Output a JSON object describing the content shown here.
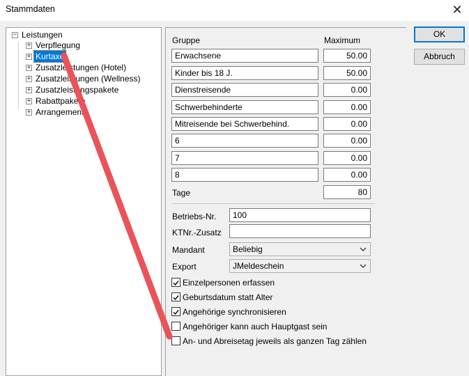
{
  "window": {
    "title": "Stammdaten"
  },
  "tree": {
    "root": "Leistungen",
    "items": [
      {
        "label": "Verpflegung"
      },
      {
        "label": "Kurtaxe"
      },
      {
        "label": "Zusatzleistungen (Hotel)"
      },
      {
        "label": "Zusatzleistungen (Wellness)"
      },
      {
        "label": "Zusatzleistungspakete"
      },
      {
        "label": "Rabattpakete"
      },
      {
        "label": "Arrangements"
      }
    ]
  },
  "form": {
    "col_gruppe": "Gruppe",
    "col_maximum": "Maximum",
    "rows": [
      {
        "gruppe": "Erwachsene",
        "maximum": "50.00"
      },
      {
        "gruppe": "Kinder bis 18 J.",
        "maximum": "50.00"
      },
      {
        "gruppe": "Dienstreisende",
        "maximum": "0.00"
      },
      {
        "gruppe": "Schwerbehinderte",
        "maximum": "0.00"
      },
      {
        "gruppe": "Mitreisende bei Schwerbehind.",
        "maximum": "0.00"
      },
      {
        "gruppe": "6",
        "maximum": "0.00"
      },
      {
        "gruppe": "7",
        "maximum": "0.00"
      },
      {
        "gruppe": "8",
        "maximum": "0.00"
      }
    ],
    "tage_label": "Tage",
    "tage_value": "80",
    "betriebsnr_label": "Betriebs-Nr.",
    "betriebsnr_value": "100",
    "ktnr_label": "KTNr.-Zusatz",
    "ktnr_value": "",
    "mandant_label": "Mandant",
    "mandant_value": "Beliebig",
    "export_label": "Export",
    "export_value": "JMeldeschein",
    "checkboxes": [
      {
        "label": "Einzelpersonen erfassen",
        "checked": true
      },
      {
        "label": "Geburtsdatum statt Alter",
        "checked": true
      },
      {
        "label": "Angehörige synchronisieren",
        "checked": true
      },
      {
        "label": "Angehöriger kann auch Hauptgast sein",
        "checked": false
      },
      {
        "label": "An- und Abreisetag jeweils als ganzen Tag zählen",
        "checked": false
      }
    ]
  },
  "buttons": {
    "ok": "OK",
    "cancel": "Abbruch"
  },
  "annotation": {
    "color": "#e8545a"
  }
}
